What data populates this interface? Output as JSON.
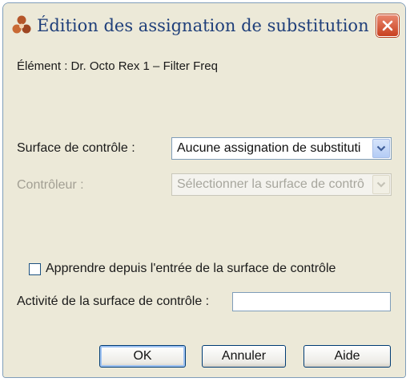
{
  "dialog": {
    "title": "Édition des assignation de substitution",
    "element_label": "Élément : Dr. Octo Rex 1 – Filter Freq",
    "surface": {
      "label": "Surface de contrôle :",
      "selected": "Aucune assignation de substituti"
    },
    "controller": {
      "label": "Contrôleur :",
      "selected": "Sélectionner la surface de contrô"
    },
    "learn": {
      "label": "Apprendre depuis l'entrée de la surface de contrôle",
      "checked": false
    },
    "activity": {
      "label": "Activité de la surface de contrôle :",
      "value": ""
    },
    "buttons": {
      "ok": "OK",
      "cancel": "Annuler",
      "help": "Aide"
    }
  },
  "colors": {
    "title_text": "#1f3f7a",
    "close_button": "#c8401f",
    "dialog_background": "#ece9d8",
    "disabled_text": "#a29f93"
  },
  "icons": {
    "app": "reason-logo-icon",
    "close": "close-icon",
    "dropdown": "chevron-down-icon"
  }
}
